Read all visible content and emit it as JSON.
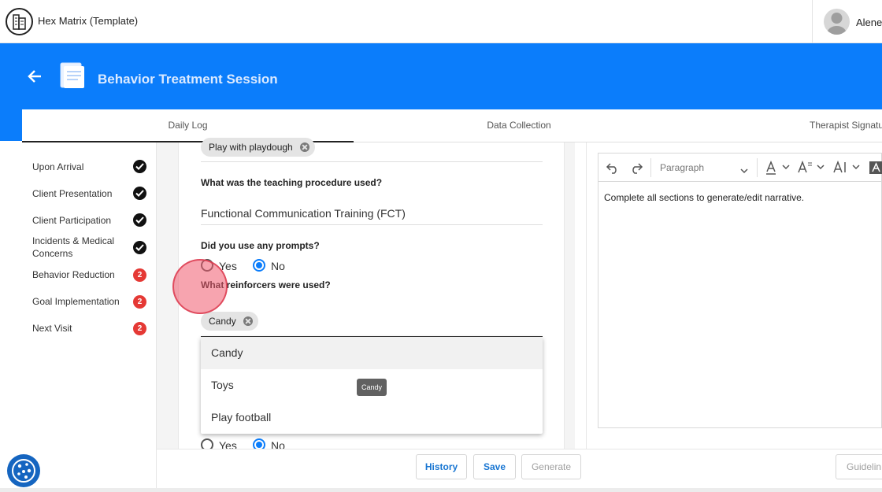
{
  "app": {
    "title": "Hex Matrix (Template)"
  },
  "user": {
    "name": "Alene"
  },
  "header": {
    "title": "Behavior Treatment Session"
  },
  "tabs": [
    {
      "label": "Daily Log",
      "active": true
    },
    {
      "label": "Data Collection",
      "active": false
    },
    {
      "label": "Therapist Signatu",
      "active": false
    }
  ],
  "sidebar": {
    "items": [
      {
        "label": "Upon Arrival",
        "status": "done"
      },
      {
        "label": "Client Presentation",
        "status": "done"
      },
      {
        "label": "Client Participation",
        "status": "done"
      },
      {
        "label": "Incidents & Medical Concerns",
        "status": "done"
      },
      {
        "label": "Behavior Reduction",
        "status": "2"
      },
      {
        "label": "Goal Implementation",
        "status": "2"
      },
      {
        "label": "Next Visit",
        "status": "2"
      }
    ]
  },
  "form": {
    "activity_chip": "Play with playdough",
    "q_teaching": "What was the teaching procedure used?",
    "a_teaching": "Functional Communication Training (FCT)",
    "q_prompts": "Did you use any prompts?",
    "yes_label": "Yes",
    "no_label": "No",
    "q_reinforcers": "What reinforcers were used?",
    "reinforcer_chip": "Candy",
    "yes_label_2": "Yes",
    "no_label_2": "No"
  },
  "dropdown": {
    "options": [
      "Candy",
      "Toys",
      "Play football"
    ],
    "tooltip": "Candy"
  },
  "actions": {
    "history": "History",
    "save": "Save",
    "generate": "Generate",
    "guidelines": "Guidelin"
  },
  "editor": {
    "block_format": "Paragraph",
    "narrative": "Complete all sections to generate/edit narrative."
  },
  "colors": {
    "primary": "#0b7dfb",
    "alert": "#e53935",
    "link": "#1976d2"
  }
}
